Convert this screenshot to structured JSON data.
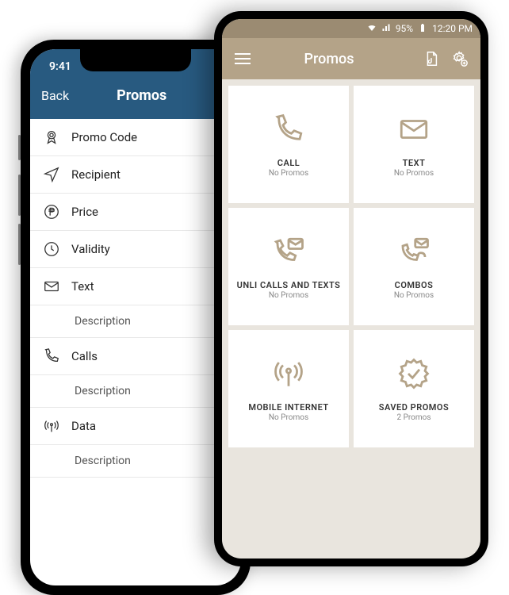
{
  "ios": {
    "status_time": "9:41",
    "back_label": "Back",
    "title": "Promos",
    "rows": [
      {
        "label": "Promo Code"
      },
      {
        "label": "Recipient"
      },
      {
        "label": "Price"
      },
      {
        "label": "Validity"
      },
      {
        "label": "Text"
      },
      {
        "label": "Description"
      },
      {
        "label": "Calls"
      },
      {
        "label": "Description"
      },
      {
        "label": "Data"
      },
      {
        "label": "Description"
      }
    ]
  },
  "android": {
    "status": {
      "battery_pct": "95%",
      "time": "12:20 PM"
    },
    "title": "Promos",
    "tiles": [
      {
        "title": "CALL",
        "sub": "No Promos"
      },
      {
        "title": "TEXT",
        "sub": "No Promos"
      },
      {
        "title": "UNLI CALLS AND TEXTS",
        "sub": "No Promos"
      },
      {
        "title": "COMBOS",
        "sub": "No Promos"
      },
      {
        "title": "MOBILE INTERNET",
        "sub": "No Promos"
      },
      {
        "title": "SAVED PROMOS",
        "sub": "2 Promos"
      }
    ]
  }
}
